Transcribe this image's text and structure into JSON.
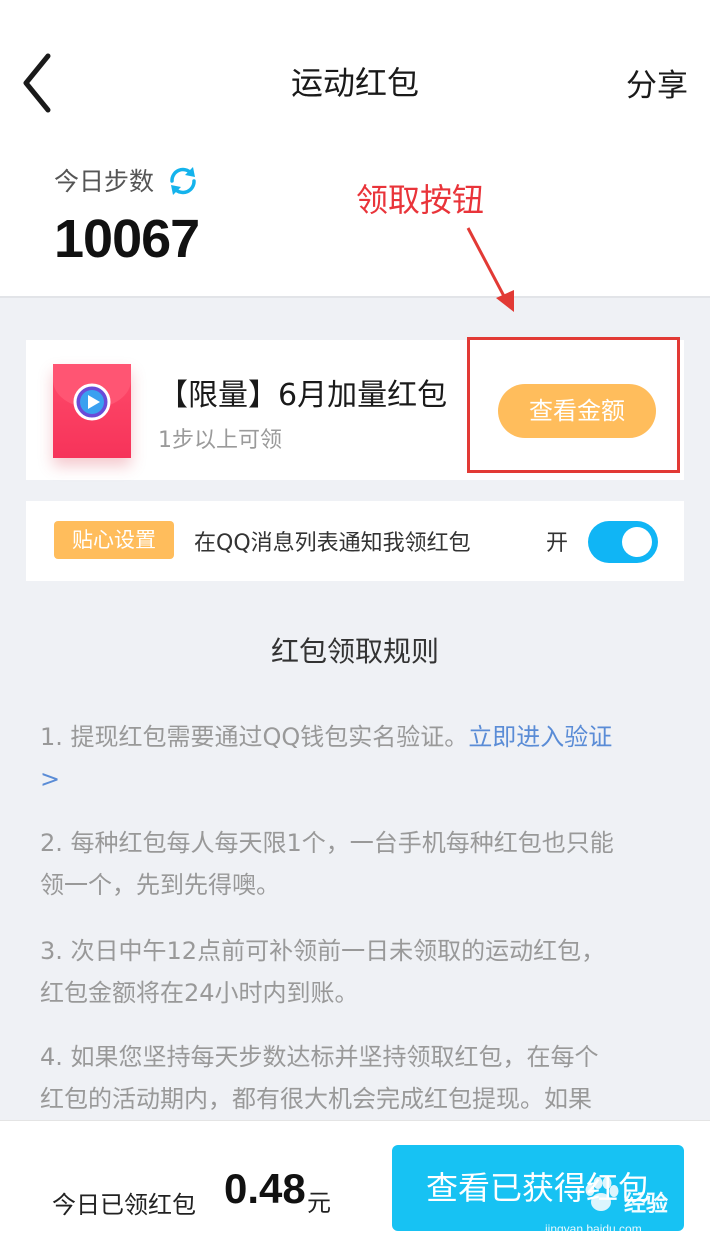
{
  "header": {
    "title": "运动红包",
    "share_label": "分享"
  },
  "steps": {
    "label": "今日步数",
    "value": "10067"
  },
  "annotation": {
    "text": "领取按钮"
  },
  "red_packet": {
    "title": "【限量】6月加量红包",
    "subtitle": "1步以上可领",
    "button_label": "查看金额"
  },
  "setting": {
    "badge": "贴心设置",
    "text": "在QQ消息列表通知我领红包",
    "toggle_label": "开",
    "toggle_on": true
  },
  "rules": {
    "title": "红包领取规则",
    "items": [
      {
        "text": "1. 提现红包需要通过QQ钱包实名验证。",
        "link": "立即进入验证",
        "link_suffix": ">"
      },
      {
        "text_line1": "2. 每种红包每人每天限1个，一台手机每种红包也只能",
        "text_line2": "领一个，先到先得噢。"
      },
      {
        "text_line1": "3. 次日中午12点前可补领前一日未领取的运动红包，",
        "text_line2": "红包金额将在24小时内到账。"
      },
      {
        "text_line1": "4. 如果您坚持每天步数达标并坚持领取红包，在每个",
        "text_line2": "红包的活动期内，都有很大机会完成红包提现。如果"
      }
    ]
  },
  "bottom": {
    "got_label": "今日已领红包",
    "got_amount": "0.48",
    "got_unit": "元",
    "button_label": "查看已获得红包"
  },
  "watermark": {
    "text": "经验",
    "url": "jingyan.baidu.com"
  },
  "colors": {
    "accent_blue": "#17c2f3",
    "button_orange": "#ffbd5c",
    "annotation_red": "#e9343a",
    "packet_red": "#f6335a"
  }
}
